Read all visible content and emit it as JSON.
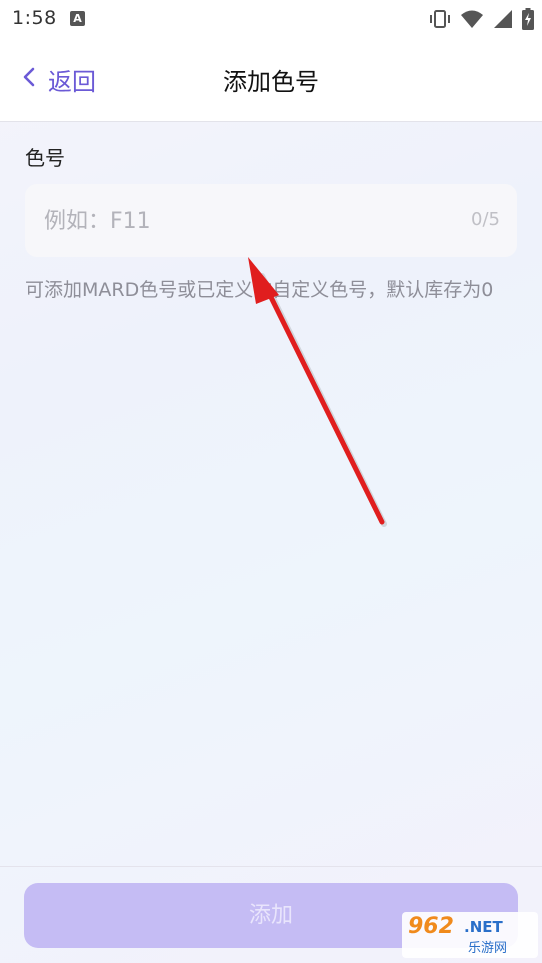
{
  "status_bar": {
    "time": "1:58",
    "notification_icon": "a-icon",
    "icons": [
      "vibrate-icon",
      "wifi-icon",
      "signal-icon",
      "battery-icon"
    ]
  },
  "header": {
    "back_label": "返回",
    "back_icon": "chevron-left-icon",
    "title": "添加色号"
  },
  "form": {
    "field_label": "色号",
    "input_value": "",
    "input_placeholder": "例如：F11",
    "char_counter": "0/5",
    "helper_text": "可添加MARD色号或已定义的自定义色号，默认库存为0"
  },
  "footer": {
    "add_button_label": "添加"
  },
  "watermark": {
    "main": "962",
    "net": ".NET",
    "sub": "乐游网"
  },
  "colors": {
    "accent": "#6b5ad6",
    "button_disabled": "#c5bcf4",
    "annotation_arrow": "#e01e1e"
  }
}
